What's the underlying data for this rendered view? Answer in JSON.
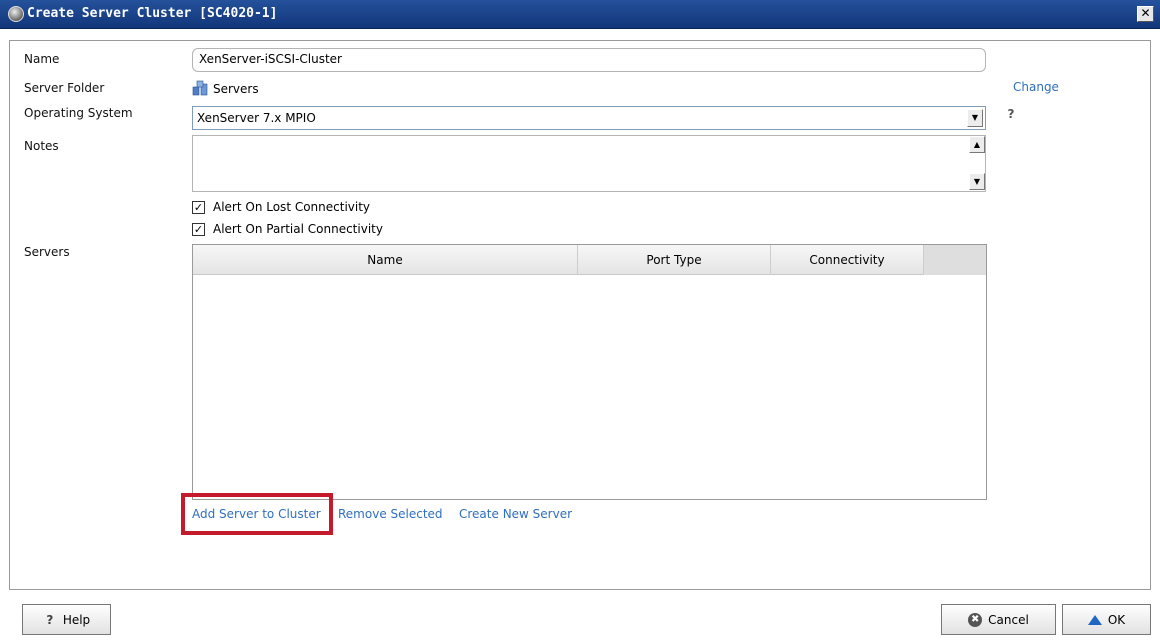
{
  "window": {
    "title": "Create Server Cluster [SC4020-1]"
  },
  "labels": {
    "name": "Name",
    "server_folder": "Server Folder",
    "operating_system": "Operating System",
    "notes": "Notes",
    "servers": "Servers"
  },
  "fields": {
    "name_value": "XenServer-iSCSI-Cluster",
    "server_folder_value": "Servers",
    "change_link": "Change",
    "os_value": "XenServer 7.x MPIO",
    "notes_value": ""
  },
  "checkboxes": [
    {
      "label": "Alert On Lost Connectivity",
      "checked": true
    },
    {
      "label": "Alert On Partial Connectivity",
      "checked": true
    }
  ],
  "servers_table": {
    "columns": [
      "Name",
      "Port Type",
      "Connectivity"
    ],
    "rows": []
  },
  "actions": {
    "add_server": "Add Server to Cluster",
    "remove_selected": "Remove Selected",
    "create_new_server": "Create New Server"
  },
  "buttons": {
    "help": "Help",
    "cancel": "Cancel",
    "ok": "OK"
  },
  "icons": {
    "question": "?",
    "close": "✕",
    "checkmark": "✓",
    "cancel": "✖",
    "arrow_down": "▼",
    "arrow_up": "▲"
  },
  "colors": {
    "titlebar": "#1a3f86",
    "link": "#2f6fbf",
    "highlight": "#c41b2c"
  }
}
